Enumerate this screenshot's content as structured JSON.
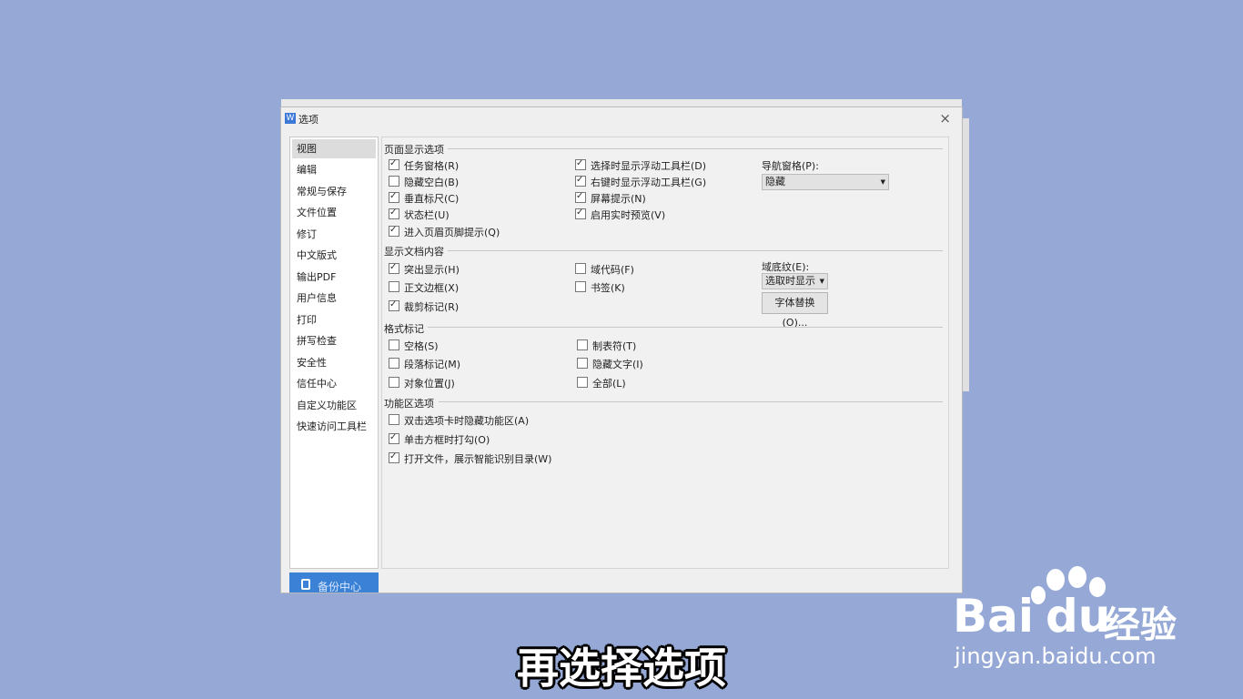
{
  "window": {
    "title": "选项",
    "close": "×",
    "app_icon": "W"
  },
  "sidebar": {
    "items": [
      {
        "label": "视图",
        "active": true
      },
      {
        "label": "编辑"
      },
      {
        "label": "常规与保存"
      },
      {
        "label": "文件位置"
      },
      {
        "label": "修订"
      },
      {
        "label": "中文版式"
      },
      {
        "label": "输出PDF"
      },
      {
        "label": "用户信息"
      },
      {
        "label": "打印"
      },
      {
        "label": "拼写检查"
      },
      {
        "label": "安全性"
      },
      {
        "label": "信任中心"
      },
      {
        "label": "自定义功能区"
      },
      {
        "label": "快速访问工具栏"
      }
    ],
    "backup_label": "备份中心"
  },
  "sections": {
    "page_display": {
      "title": "页面显示选项",
      "options": [
        {
          "label": "任务窗格(R)",
          "checked": true
        },
        {
          "label": "隐藏空白(B)",
          "checked": false
        },
        {
          "label": "垂直标尺(C)",
          "checked": true
        },
        {
          "label": "状态栏(U)",
          "checked": true
        },
        {
          "label": "进入页眉页脚提示(Q)",
          "checked": true
        },
        {
          "label": "选择时显示浮动工具栏(D)",
          "checked": true
        },
        {
          "label": "右键时显示浮动工具栏(G)",
          "checked": true
        },
        {
          "label": "屏幕提示(N)",
          "checked": true
        },
        {
          "label": "启用实时预览(V)",
          "checked": true
        }
      ],
      "nav_label": "导航窗格(P):",
      "nav_value": "隐藏"
    },
    "doc_content": {
      "title": "显示文档内容",
      "options": [
        {
          "label": "突出显示(H)",
          "checked": true
        },
        {
          "label": "正文边框(X)",
          "checked": false
        },
        {
          "label": "裁剪标记(R)",
          "checked": true
        },
        {
          "label": "域代码(F)",
          "checked": false
        },
        {
          "label": "书签(K)",
          "checked": false
        }
      ],
      "field_label": "域底纹(E):",
      "field_value": "选取时显示",
      "font_btn": "字体替换(O)..."
    },
    "format_marks": {
      "title": "格式标记",
      "options": [
        {
          "label": "空格(S)",
          "checked": false
        },
        {
          "label": "段落标记(M)",
          "checked": false
        },
        {
          "label": "对象位置(J)",
          "checked": false
        },
        {
          "label": "制表符(T)",
          "checked": false
        },
        {
          "label": "隐藏文字(I)",
          "checked": false
        },
        {
          "label": "全部(L)",
          "checked": false
        }
      ]
    },
    "ribbon": {
      "title": "功能区选项",
      "options": [
        {
          "label": "双击选项卡时隐藏功能区(A)",
          "checked": false
        },
        {
          "label": "单击方框时打勾(O)",
          "checked": true
        },
        {
          "label": "打开文件，展示智能识别目录(W)",
          "checked": true
        }
      ]
    }
  },
  "subtitle": "再选择选项",
  "watermark": {
    "brand": "Bai",
    "brand2": "du",
    "cn": "经验",
    "url": "jingyan.baidu.com"
  }
}
